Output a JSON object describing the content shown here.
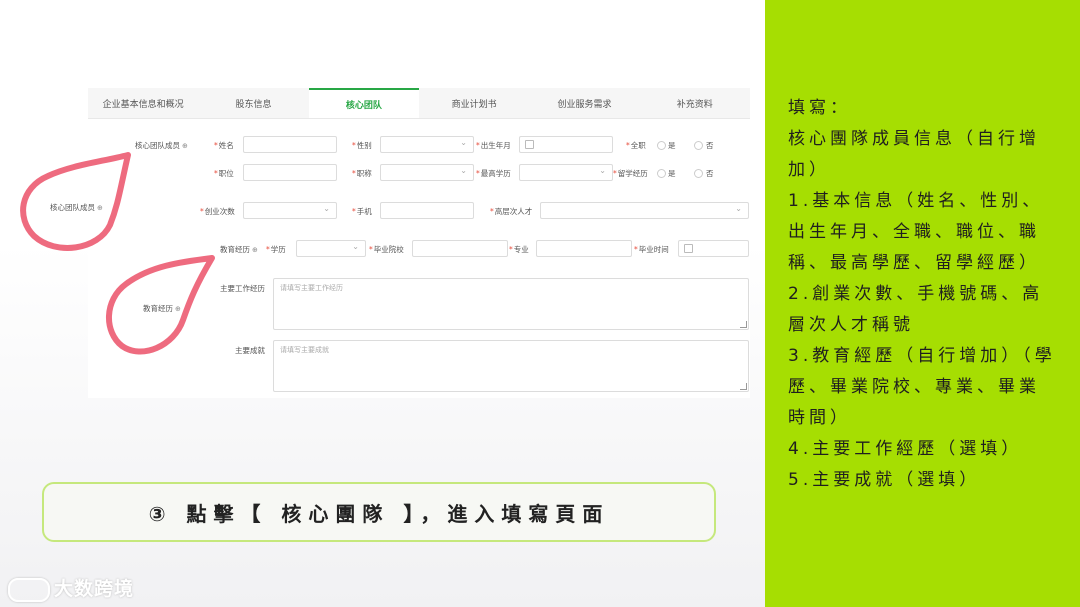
{
  "tabs": [
    "企业基本信息和概况",
    "股东信息",
    "核心团队",
    "商业计划书",
    "创业服务需求",
    "补充资料"
  ],
  "active_tab": "核心团队",
  "form": {
    "section_team": "核心团队成员",
    "name": "姓名",
    "gender": "性别",
    "birth": "出生年月",
    "fulltime": "全职",
    "yes": "是",
    "no": "否",
    "position": "职位",
    "title": "职称",
    "degree": "最高学历",
    "study_abroad": "留学经历",
    "startup_count": "创业次数",
    "phone": "手机",
    "talent": "高层次人才",
    "edu_section": "教育经历",
    "edu": "学历",
    "school": "毕业院校",
    "major": "专业",
    "grad_time": "毕业时间",
    "work_label": "主要工作经历",
    "work_placeholder": "请填写主要工作经历",
    "achieve_label": "主要成就",
    "achieve_placeholder": "请填写主要成就"
  },
  "callouts": {
    "team_member": "核心团队成员",
    "education": "教育经历"
  },
  "banner": "③ 點擊【 核心團隊 】，進入填寫頁面",
  "right_panel": {
    "lines": [
      "填寫：",
      "核心團隊成員信息（自行增加）",
      "1.基本信息（姓名、性別、出生年月、全職、職位、職稱、最高學歷、留學經歷）",
      "2.創業次數、手機號碼、高層次人才稱號",
      "3.教育經歷（自行增加）（學歷、畢業院校、專業、畢業時間）",
      "4.主要工作經歷（選填）",
      "5.主要成就（選填）"
    ]
  },
  "logo": "大数跨境",
  "colors": {
    "accent_green": "#a6de02",
    "active_tab": "#28a745",
    "callout_pink": "#ee6b7f"
  }
}
